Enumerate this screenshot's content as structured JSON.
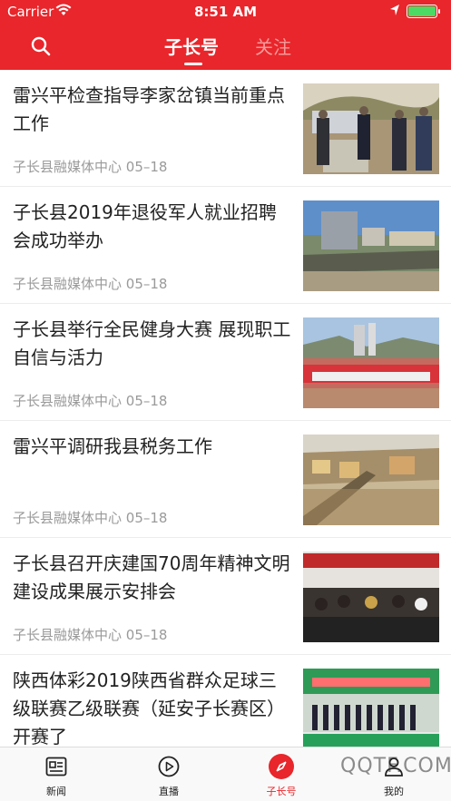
{
  "status_bar": {
    "carrier": "Carrier",
    "time": "8:51 AM"
  },
  "header": {
    "tabs": [
      {
        "label": "子长号",
        "active": true
      },
      {
        "label": "关注",
        "active": false
      }
    ],
    "color": "#e8262b"
  },
  "news": [
    {
      "title": "雷兴平检查指导李家岔镇当前重点工作",
      "source": "子长县融媒体中心",
      "date": "05–18"
    },
    {
      "title": "子长县2019年退役军人就业招聘会成功举办",
      "source": "子长县融媒体中心",
      "date": "05–18"
    },
    {
      "title": "子长县举行全民健身大赛 展现职工自信与活力",
      "source": "子长县融媒体中心",
      "date": "05–18"
    },
    {
      "title": "雷兴平调研我县税务工作",
      "source": "子长县融媒体中心",
      "date": "05–18"
    },
    {
      "title": "子长县召开庆建国70周年精神文明建设成果展示安排会",
      "source": "子长县融媒体中心",
      "date": "05–18"
    },
    {
      "title": "陕西体彩2019陕西省群众足球三级联赛乙级联赛（延安子长赛区）开赛了",
      "source": "",
      "date": ""
    }
  ],
  "tabbar": [
    {
      "label": "新闻",
      "icon": "news-icon"
    },
    {
      "label": "直播",
      "icon": "play-icon"
    },
    {
      "label": "子长号",
      "icon": "compass-icon",
      "active": true
    },
    {
      "label": "我的",
      "icon": "user-icon"
    }
  ],
  "watermark": "QQTF.COM"
}
